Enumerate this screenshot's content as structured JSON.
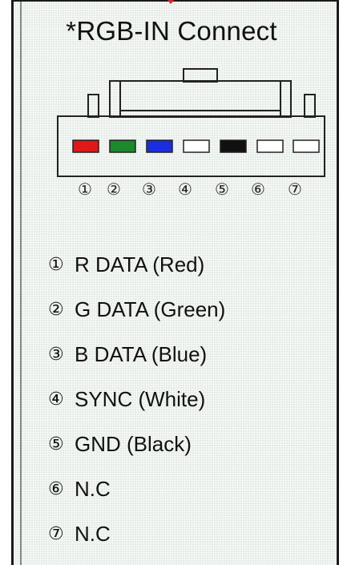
{
  "title": "*RGB-IN Connect",
  "accent_color": "#e82020",
  "pins": [
    {
      "symbol": "①",
      "label": "R DATA (Red)",
      "color": "#e01818"
    },
    {
      "symbol": "②",
      "label": "G DATA (Green)",
      "color": "#1a8a2a"
    },
    {
      "symbol": "③",
      "label": "B DATA (Blue)",
      "color": "#1a2ee0"
    },
    {
      "symbol": "④",
      "label": "SYNC (White)",
      "color": "#ffffff"
    },
    {
      "symbol": "⑤",
      "label": "GND (Black)",
      "color": "#111111"
    },
    {
      "symbol": "⑥",
      "label": "N.C",
      "color": "#ffffff"
    },
    {
      "symbol": "⑦",
      "label": "N.C",
      "color": "#ffffff"
    }
  ]
}
